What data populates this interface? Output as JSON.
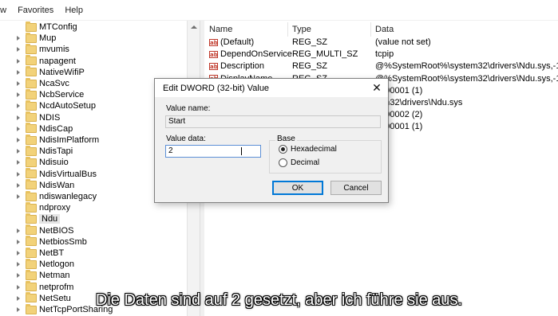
{
  "menubar": {
    "items": [
      "ew",
      "Favorites",
      "Help"
    ]
  },
  "tree": {
    "items": [
      {
        "label": "MTConfig",
        "expander": false
      },
      {
        "label": "Mup",
        "expander": true
      },
      {
        "label": "mvumis",
        "expander": true
      },
      {
        "label": "napagent",
        "expander": true
      },
      {
        "label": "NativeWifiP",
        "expander": true
      },
      {
        "label": "NcaSvc",
        "expander": true
      },
      {
        "label": "NcbService",
        "expander": true
      },
      {
        "label": "NcdAutoSetup",
        "expander": true
      },
      {
        "label": "NDIS",
        "expander": true
      },
      {
        "label": "NdisCap",
        "expander": true
      },
      {
        "label": "NdisImPlatform",
        "expander": true
      },
      {
        "label": "NdisTapi",
        "expander": true
      },
      {
        "label": "Ndisuio",
        "expander": true
      },
      {
        "label": "NdisVirtualBus",
        "expander": true
      },
      {
        "label": "NdisWan",
        "expander": true
      },
      {
        "label": "ndiswanlegacy",
        "expander": true
      },
      {
        "label": "ndproxy",
        "expander": false
      },
      {
        "label": "Ndu",
        "expander": false,
        "selected": true
      },
      {
        "label": "NetBIOS",
        "expander": true
      },
      {
        "label": "NetbiosSmb",
        "expander": true
      },
      {
        "label": "NetBT",
        "expander": true
      },
      {
        "label": "Netlogon",
        "expander": true
      },
      {
        "label": "Netman",
        "expander": true
      },
      {
        "label": "netprofm",
        "expander": true
      },
      {
        "label": "NetSetu",
        "expander": true
      },
      {
        "label": "NetTcpPortSharing",
        "expander": true
      }
    ]
  },
  "values": {
    "headers": {
      "name": "Name",
      "type": "Type",
      "data": "Data"
    },
    "rows": [
      {
        "name": "(Default)",
        "type": "REG_SZ",
        "data": "(value not set)"
      },
      {
        "name": "DependOnService",
        "type": "REG_MULTI_SZ",
        "data": "tcpip"
      },
      {
        "name": "Description",
        "type": "REG_SZ",
        "data": "@%SystemRoot%\\system32\\drivers\\Ndu.sys,-100"
      },
      {
        "name": "DisplayName",
        "type": "REG_SZ",
        "data": "@%SystemRoot%\\system32\\drivers\\Ndu.sys,-100"
      },
      {
        "name": "",
        "type": "",
        "data": "0000001 (1)"
      },
      {
        "name": "",
        "type": "",
        "data": "tem32\\drivers\\Ndu.sys"
      },
      {
        "name": "",
        "type": "",
        "data": "0000002 (2)"
      },
      {
        "name": "",
        "type": "",
        "data": "0000001 (1)"
      }
    ]
  },
  "dialog": {
    "title": "Edit DWORD (32-bit) Value",
    "close_glyph": "✕",
    "value_name_label": "Value name:",
    "value_name": "Start",
    "value_data_label": "Value data:",
    "value_data": "2",
    "base_label": "Base",
    "hex_label": "Hexadecimal",
    "dec_label": "Decimal",
    "selected_base": "Hexadecimal",
    "ok_label": "OK",
    "cancel_label": "Cancel"
  },
  "subtitle": "Die Daten sind auf 2 gesetzt, aber ich führe sie aus."
}
